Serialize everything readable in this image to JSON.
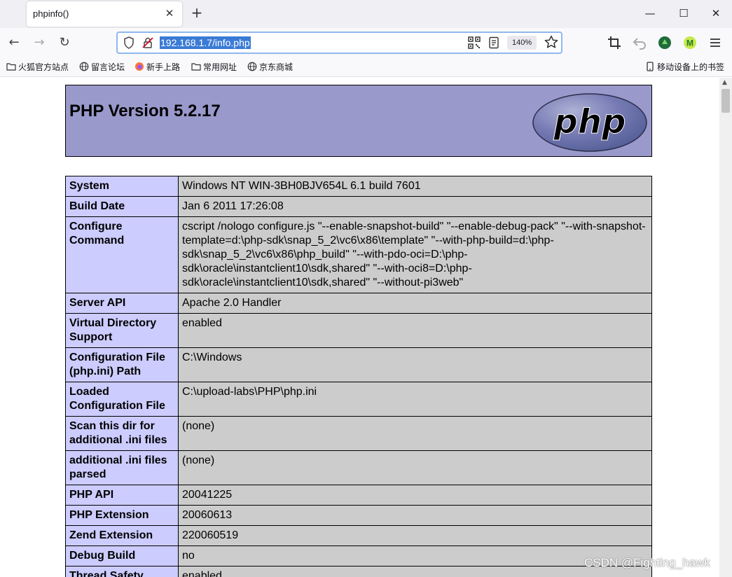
{
  "browser": {
    "tab": {
      "title": "phpinfo()"
    },
    "address": {
      "url": "192.168.1.7/info.php",
      "zoom": "140%"
    },
    "bookmarks": [
      {
        "label": "火狐官方站点",
        "icon": "folder-icon"
      },
      {
        "label": "留言论坛",
        "icon": "globe-icon"
      },
      {
        "label": "新手上路",
        "icon": "firefox-icon"
      },
      {
        "label": "常用网址",
        "icon": "folder-icon"
      },
      {
        "label": "京东商城",
        "icon": "globe-icon"
      }
    ],
    "mobile_bookmarks": "移动设备上的书签"
  },
  "page": {
    "heading": "PHP Version 5.2.17",
    "logo_text": "php",
    "rows": [
      {
        "label": "System",
        "value": "Windows NT WIN-3BH0BJV654L 6.1 build 7601"
      },
      {
        "label": "Build Date",
        "value": "Jan 6 2011 17:26:08"
      },
      {
        "label": "Configure Command",
        "value": "cscript /nologo configure.js \"--enable-snapshot-build\" \"--enable-debug-pack\" \"--with-snapshot-template=d:\\php-sdk\\snap_5_2\\vc6\\x86\\template\" \"--with-php-build=d:\\php-sdk\\snap_5_2\\vc6\\x86\\php_build\" \"--with-pdo-oci=D:\\php-sdk\\oracle\\instantclient10\\sdk,shared\" \"--with-oci8=D:\\php-sdk\\oracle\\instantclient10\\sdk,shared\" \"--without-pi3web\""
      },
      {
        "label": "Server API",
        "value": "Apache 2.0 Handler"
      },
      {
        "label": "Virtual Directory Support",
        "value": "enabled"
      },
      {
        "label": "Configuration File (php.ini) Path",
        "value": "C:\\Windows"
      },
      {
        "label": "Loaded Configuration File",
        "value": "C:\\upload-labs\\PHP\\php.ini"
      },
      {
        "label": "Scan this dir for additional .ini files",
        "value": "(none)"
      },
      {
        "label": "additional .ini files parsed",
        "value": "(none)"
      },
      {
        "label": "PHP API",
        "value": "20041225"
      },
      {
        "label": "PHP Extension",
        "value": "20060613"
      },
      {
        "label": "Zend Extension",
        "value": "220060519"
      },
      {
        "label": "Debug Build",
        "value": "no"
      },
      {
        "label": "Thread Safety",
        "value": "enabled"
      }
    ]
  },
  "watermark": "CSDN @Fighting_hawk",
  "colors": {
    "header_bg": "#9999cc",
    "label_bg": "#ccccff",
    "value_bg": "#cccccc",
    "url_highlight": "#3a7bd5"
  }
}
